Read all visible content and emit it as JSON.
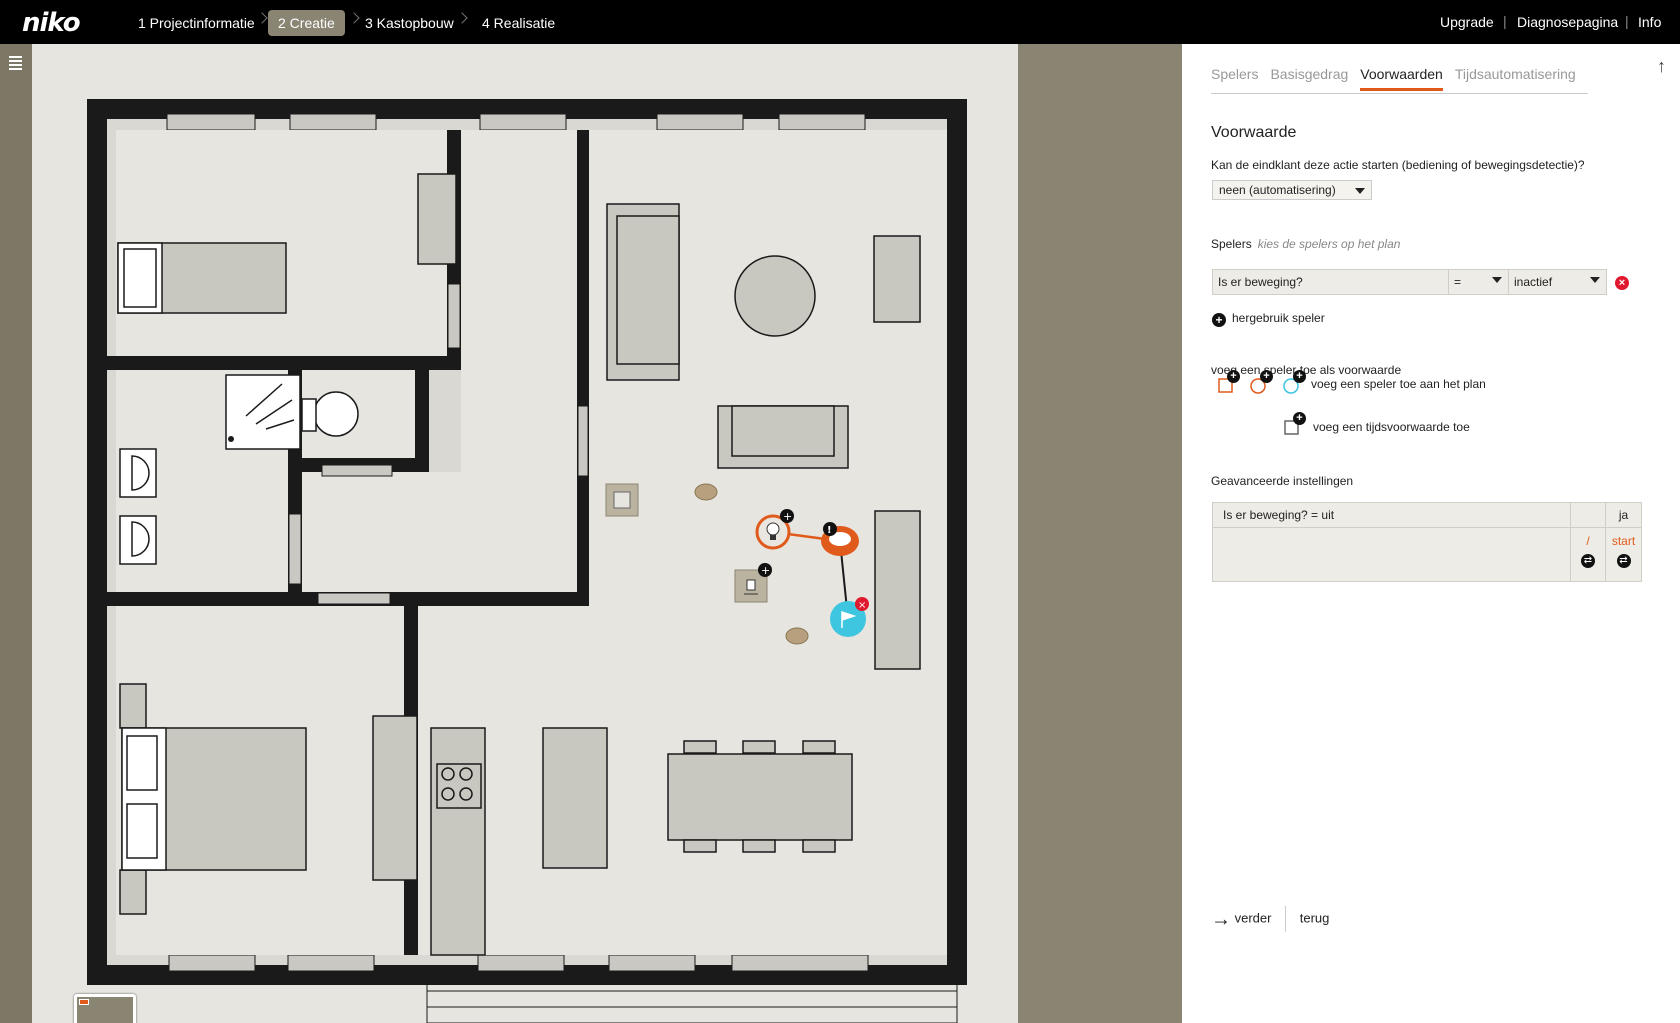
{
  "brand": {
    "logo": "niko"
  },
  "steps": [
    {
      "label": "1 Projectinformatie",
      "active": false
    },
    {
      "label": "2 Creatie",
      "active": true
    },
    {
      "label": "3 Kastopbouw",
      "active": false
    },
    {
      "label": "4 Realisatie",
      "active": false
    }
  ],
  "top_links": [
    "Upgrade",
    "Diagnosepagina",
    "Info"
  ],
  "panel": {
    "tabs": [
      "Spelers",
      "Basisgedrag",
      "Voorwaarden",
      "Tijdsautomatisering"
    ],
    "active_tab": "Voorwaarden",
    "title": "Voorwaarde",
    "question": "Kan de eindklant deze actie starten (bediening of bewegingsdetectie)?",
    "question_value": "neen (automatisering)",
    "players_label": "Spelers",
    "players_hint": "kies de spelers op het plan",
    "condition": {
      "player": "Is er beweging?",
      "operator": "=",
      "value": "inactief"
    },
    "reuse_label": "hergebruik speler",
    "add_heading": "voeg een speler toe als voorwaarde",
    "add_player_plan": "voeg een speler toe aan het plan",
    "add_time_condition": "voeg een tijdsvoorwaarde toe",
    "advanced_label": "Geavanceerde instellingen",
    "advanced_row": "Is er beweging? = uit",
    "advanced_yes": "ja",
    "advanced_slash": "/",
    "advanced_start": "start",
    "next_label": "verder",
    "back_label": "terug"
  },
  "colors": {
    "accent": "#e05b1b",
    "topbar": "#000000",
    "stone": "#8a8472",
    "error": "#e0192e",
    "cyan": "#3ec5df"
  }
}
